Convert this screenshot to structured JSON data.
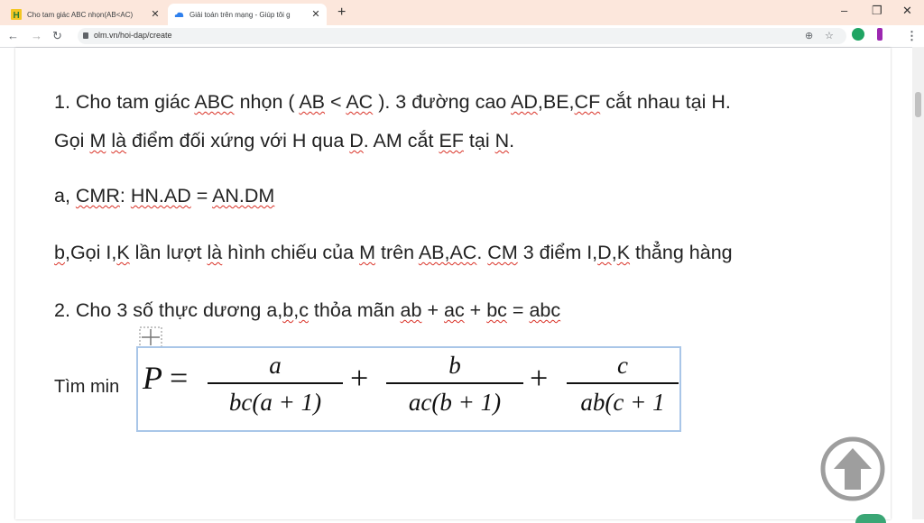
{
  "browser": {
    "tabs": [
      {
        "title": "Cho tam giác ABC nhọn(AB<AC)",
        "active": false,
        "favicon": "olm-h-icon"
      },
      {
        "title": "Giải toán trên mạng - Giúp tôi g",
        "active": true,
        "favicon": "cloud-icon"
      }
    ],
    "url": "olm.vn/hoi-dap/create",
    "window_controls": {
      "minimize": "–",
      "maximize": "❐",
      "close": "✕"
    },
    "new_tab": "+"
  },
  "question": {
    "line1": [
      {
        "t": "1. Cho tam giác "
      },
      {
        "t": "ABC",
        "sq": true
      },
      {
        "t": " nhọn ( "
      },
      {
        "t": "AB",
        "sq": true
      },
      {
        "t": " < "
      },
      {
        "t": "AC",
        "sq": true
      },
      {
        "t": " ). 3 đường cao "
      },
      {
        "t": "AD",
        "sq": true
      },
      {
        "t": ",BE,"
      },
      {
        "t": "CF",
        "sq": true
      },
      {
        "t": " cắt nhau tại H."
      }
    ],
    "line2": [
      {
        "t": "Gọi "
      },
      {
        "t": "M",
        "sq": true
      },
      {
        "t": " "
      },
      {
        "t": "là",
        "sq": true
      },
      {
        "t": " điểm đối xứng với H qua "
      },
      {
        "t": "D",
        "sq": true
      },
      {
        "t": ". AM cắt "
      },
      {
        "t": "EF",
        "sq": true
      },
      {
        "t": " tại "
      },
      {
        "t": "N",
        "sq": true
      },
      {
        "t": "."
      }
    ],
    "line3": [
      {
        "t": "a, "
      },
      {
        "t": "CMR",
        "sq": true
      },
      {
        "t": ": "
      },
      {
        "t": "HN.AD",
        "sq": true
      },
      {
        "t": " = "
      },
      {
        "t": "AN.DM",
        "sq": true
      }
    ],
    "line4": [
      {
        "t": "b",
        "sq": true
      },
      {
        "t": ",Gọi I,"
      },
      {
        "t": "K",
        "sq": true
      },
      {
        "t": " lần lượt "
      },
      {
        "t": "là",
        "sq": true
      },
      {
        "t": " hình chiếu của "
      },
      {
        "t": "M",
        "sq": true
      },
      {
        "t": " trên "
      },
      {
        "t": "AB,AC",
        "sq": true
      },
      {
        "t": ". "
      },
      {
        "t": "CM",
        "sq": true
      },
      {
        "t": " 3 điểm I,"
      },
      {
        "t": "D",
        "sq": true
      },
      {
        "t": ","
      },
      {
        "t": "K",
        "sq": true
      },
      {
        "t": " thẳng hàng"
      }
    ],
    "line5": [
      {
        "t": "2. Cho 3 số thực dương a,"
      },
      {
        "t": "b",
        "sq": true
      },
      {
        "t": ","
      },
      {
        "t": "c",
        "sq": true
      },
      {
        "t": " thỏa mãn "
      },
      {
        "t": "ab",
        "sq": true
      },
      {
        "t": " + "
      },
      {
        "t": "ac",
        "sq": true
      },
      {
        "t": " + "
      },
      {
        "t": "bc",
        "sq": true
      },
      {
        "t": " = "
      },
      {
        "t": "abc",
        "sq": true
      }
    ],
    "tim_min": "Tìm min",
    "formula": {
      "lhs": "P",
      "eq": "=",
      "plus": "+",
      "fractions": [
        {
          "num": "a",
          "den": "bc(a + 1)"
        },
        {
          "num": "b",
          "den": "ac(b + 1)"
        },
        {
          "num": "c",
          "den": "ab(c + 1"
        }
      ]
    }
  },
  "colors": {
    "tabstrip": "#fce7dc",
    "spellcheck": "#d93025",
    "formula_border": "#a9c6e8",
    "scroll_top_button": "#9e9e9e"
  }
}
